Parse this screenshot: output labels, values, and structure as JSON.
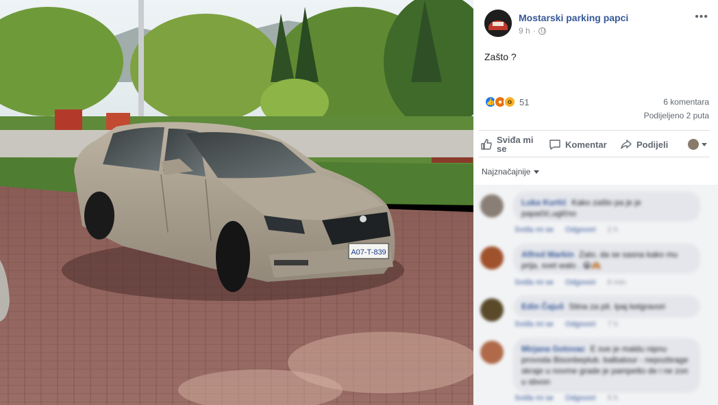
{
  "post": {
    "page_name": "Mostarski parking papci",
    "time": "9 h",
    "privacy_icon": "globe-icon",
    "text": "Zašto ?"
  },
  "reactions": {
    "icons": [
      "like-icon",
      "angry-icon",
      "wow-icon"
    ],
    "count": "51",
    "comments_count": "6 komentara",
    "shares_count": "Podijeljeno 2 puta"
  },
  "actions": {
    "like_label": "Sviđa mi se",
    "comment_label": "Komentar",
    "share_label": "Podijeli"
  },
  "photo": {
    "plate": "A07-T-839"
  },
  "sort_label": "Najznačajnije",
  "comments": [
    {
      "name": "Luka Kurtić",
      "text": "Kako zašto pa je je papačić,uglčno",
      "like": "Sviđa mi se",
      "reply": "Odgovori",
      "time": "2 h"
    },
    {
      "name": "Alfred Markin",
      "text": "Zato. da se sasna kako mu prija, svet walo . 😀🙈",
      "like": "Sviđa mi se",
      "reply": "Odgovori",
      "time": "6 min"
    },
    {
      "name": "Edin Čajuš",
      "text": "Stina za pit. Ipaj kelgravori",
      "like": "Sviđa mi se",
      "reply": "Odgovori",
      "time": "7 h"
    },
    {
      "name": "Mirjana Gotovac",
      "text": "E sve je maldu nipnu provoda Bisonbeplub. balbatour - nepozbrage skraje u novme grade je pampetto de i ne zon u sbvon",
      "like": "Sviđa mi se",
      "reply": "Odgovori",
      "time": "5 h"
    }
  ],
  "colors": {
    "link": "#365899",
    "meta": "#90949c",
    "like": "#1877f2",
    "comment_bg": "#f2f3f5"
  }
}
